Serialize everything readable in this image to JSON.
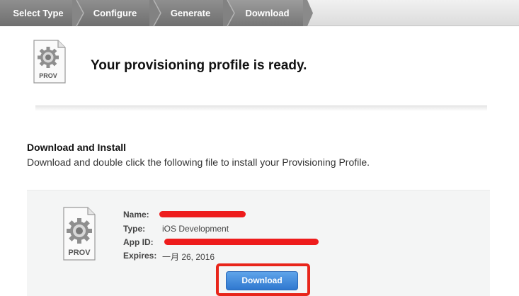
{
  "steps": [
    {
      "label": "Select Type"
    },
    {
      "label": "Configure"
    },
    {
      "label": "Generate"
    },
    {
      "label": "Download"
    }
  ],
  "header": {
    "title": "Your provisioning profile is ready.",
    "icon_label": "PROV",
    "icon": "prov-gear-document-icon"
  },
  "section": {
    "title": "Download and Install",
    "description": "Download and double click the following file to install your Provisioning Profile."
  },
  "profile": {
    "icon_label": "PROV",
    "name_label": "Name:",
    "name_value": "",
    "type_label": "Type:",
    "type_value": "iOS Development",
    "app_id_label": "App ID:",
    "app_id_value": "",
    "expires_label": "Expires:",
    "expires_value": "一月 26, 2016"
  },
  "actions": {
    "download_label": "Download"
  },
  "colors": {
    "step_bar": "#7a7a7a",
    "download_button": "#3c86d9",
    "highlight": "#e8251a",
    "redaction": "#ee1c1c"
  }
}
